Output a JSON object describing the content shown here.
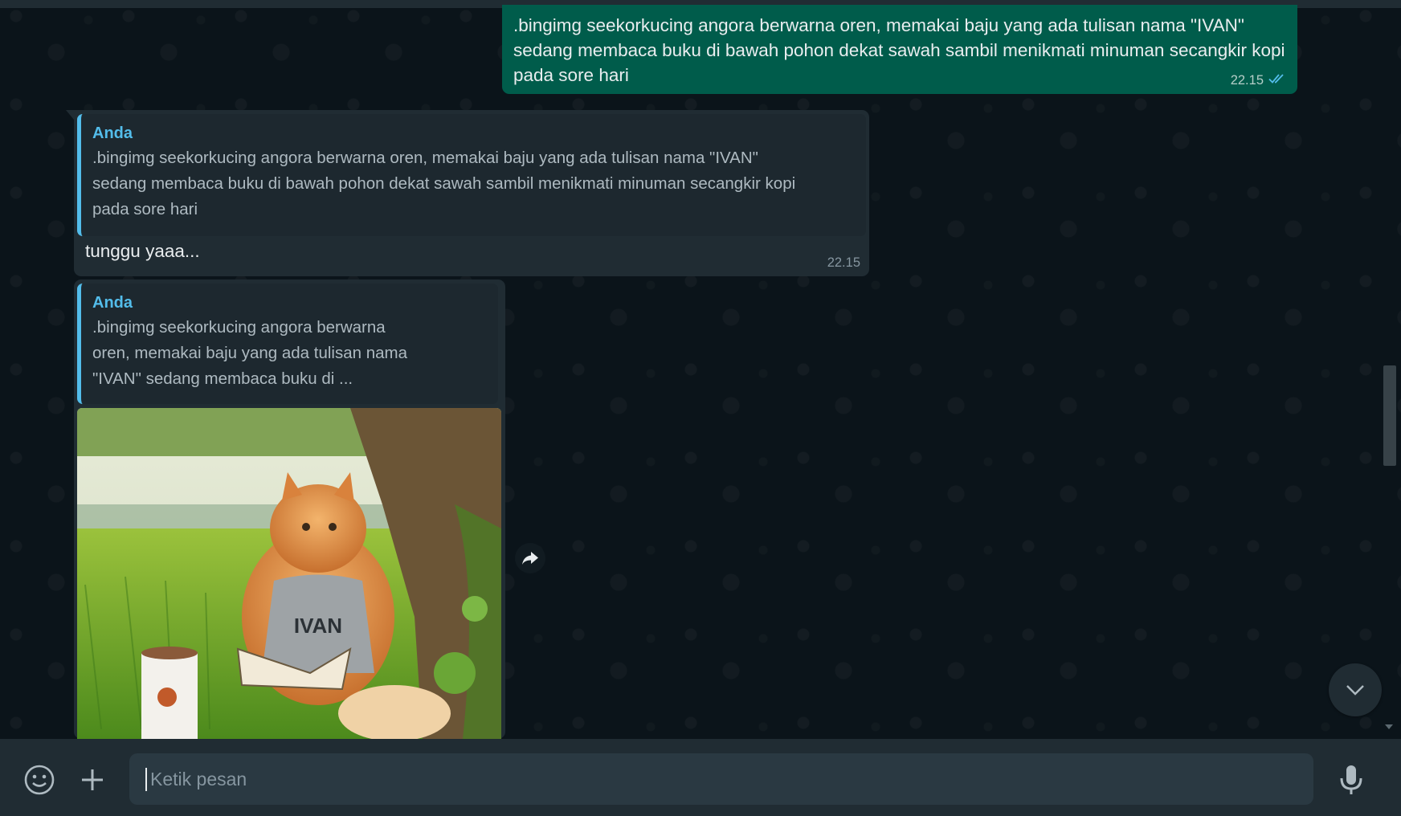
{
  "messages": {
    "outgoing": {
      "text": ".bingimg seekorkucing angora berwarna oren, memakai baju yang ada tulisan nama \"IVAN\" sedang membaca buku di bawah pohon dekat sawah sambil menikmati minuman secangkir kopi pada sore hari",
      "time": "22.15",
      "status_icon": "double-check-icon"
    },
    "reply_text": {
      "quote_author": "Anda",
      "quote_text": ".bingimg seekorkucing angora berwarna oren, memakai baju yang ada tulisan nama \"IVAN\" sedang membaca buku di bawah pohon dekat sawah sambil menikmati minuman secangkir kopi pada sore hari",
      "text": "tunggu yaaa...",
      "time": "22.15"
    },
    "reply_image": {
      "quote_author": "Anda",
      "quote_text": ".bingimg seekorkucing angora berwarna oren, memakai baju yang ada tulisan nama \"IVAN\" sedang membaca buku di ...",
      "image_shirt_text": "IVAN"
    }
  },
  "composer": {
    "placeholder": "Ketik pesan",
    "emoji_icon": "emoji-icon",
    "attach_icon": "plus-icon",
    "mic_icon": "mic-icon"
  },
  "colors": {
    "background": "#0b141a",
    "panel": "#202c33",
    "outgoing_bubble": "#005c4b",
    "incoming_bubble": "#202c33",
    "accent_blue": "#53bdeb"
  }
}
